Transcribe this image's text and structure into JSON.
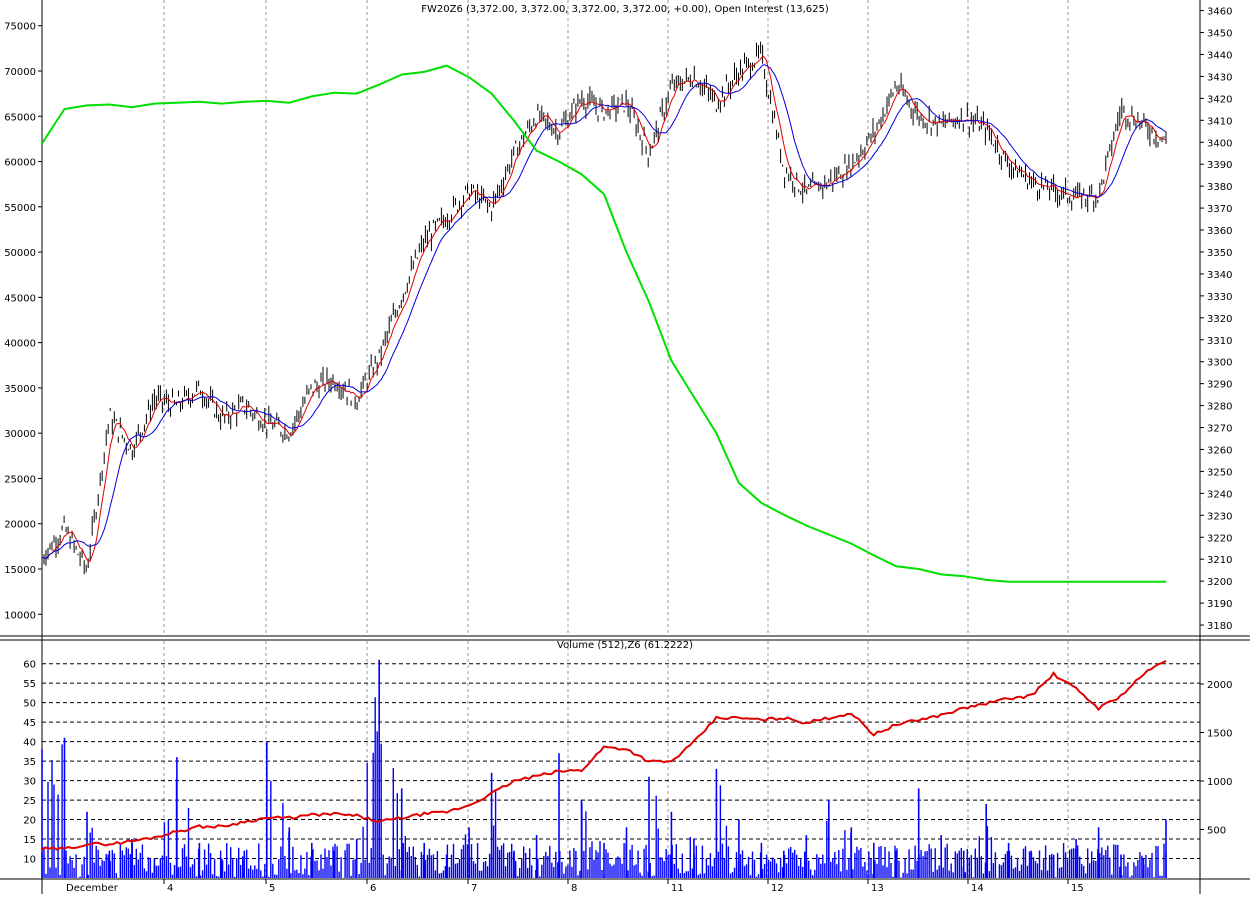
{
  "chart_data": [
    {
      "type": "line",
      "title": "FW20Z6 (3,372.00, 3,372.00, 3,372.00, 3,372.00, +0.00), Open Interest (13,625)",
      "x_labels": [
        "December",
        "4",
        "5",
        "6",
        "7",
        "8",
        "11",
        "12",
        "13",
        "14",
        "15"
      ],
      "left_axis": {
        "ticks": [
          10000,
          15000,
          20000,
          25000,
          30000,
          35000,
          40000,
          45000,
          50000,
          55000,
          60000,
          65000,
          70000,
          75000
        ],
        "range": [
          7600,
          77400
        ]
      },
      "right_axis": {
        "ticks": [
          3180,
          3190,
          3200,
          3210,
          3220,
          3230,
          3240,
          3250,
          3260,
          3270,
          3280,
          3290,
          3300,
          3310,
          3320,
          3330,
          3340,
          3350,
          3360,
          3370,
          3380,
          3390,
          3400,
          3410,
          3420,
          3430,
          3440,
          3450,
          3460
        ],
        "range": [
          3175,
          3463
        ]
      },
      "grid": "vertical dotted at session boundaries",
      "series": [
        {
          "kind": "price-bars",
          "axis": "right",
          "color": "#000000",
          "x": [
            0,
            2,
            4,
            6,
            8,
            10,
            12,
            14,
            16,
            18,
            20,
            22,
            24,
            26,
            28,
            30,
            32,
            34,
            36,
            38,
            40,
            42,
            44,
            46,
            48,
            50,
            52,
            54,
            56,
            58,
            60,
            62,
            64,
            66,
            68,
            70,
            72,
            74,
            76,
            78,
            80,
            82,
            84,
            86,
            88,
            90,
            92,
            94,
            96,
            98,
            100
          ],
          "values": [
            3211,
            3224,
            3205,
            3275,
            3260,
            3283,
            3280,
            3288,
            3274,
            3280,
            3272,
            3268,
            3288,
            3292,
            3283,
            3302,
            3330,
            3355,
            3366,
            3378,
            3370,
            3395,
            3412,
            3405,
            3420,
            3414,
            3418,
            3395,
            3425,
            3430,
            3418,
            3432,
            3440,
            3388,
            3377,
            3382,
            3390,
            3404,
            3426,
            3412,
            3408,
            3412,
            3406,
            3390,
            3382,
            3378,
            3375,
            3376,
            3415,
            3408,
            3400
          ]
        },
        {
          "kind": "open-interest",
          "axis": "left",
          "color": "#00e000",
          "x": [
            0,
            2,
            4,
            6,
            8,
            10,
            12,
            14,
            16,
            18,
            20,
            22,
            24,
            26,
            28,
            30,
            32,
            34,
            36,
            38,
            40,
            42,
            44,
            46,
            48,
            50,
            52,
            54,
            56,
            58,
            60,
            62,
            64,
            66,
            68,
            70,
            72,
            74,
            76,
            78,
            80,
            82,
            84,
            86,
            88,
            90,
            92,
            94,
            96,
            98,
            100
          ],
          "values": [
            62000,
            65800,
            66200,
            66300,
            66000,
            66400,
            66500,
            66600,
            66400,
            66600,
            66700,
            66500,
            67200,
            67600,
            67500,
            68500,
            69600,
            69900,
            70600,
            69300,
            67500,
            64500,
            61200,
            60000,
            58600,
            56400,
            50000,
            44500,
            38000,
            34000,
            30000,
            24500,
            22300,
            21000,
            19800,
            18800,
            17800,
            16500,
            15300,
            15000,
            14400,
            14200,
            13800,
            13600,
            13600,
            13600,
            13600,
            13600,
            13600,
            13600,
            13600
          ]
        }
      ]
    },
    {
      "type": "bar",
      "title": "Volume (512),Z6 (61.2222)",
      "left_axis": {
        "ticks": [
          10,
          15,
          20,
          25,
          30,
          35,
          40,
          45,
          50,
          55,
          60
        ],
        "range": [
          5,
          63
        ]
      },
      "right_axis": {
        "ticks": [
          500,
          1000,
          1500,
          2000
        ],
        "range": [
          0,
          2330
        ]
      },
      "grid": "horizontal dashed",
      "series": [
        {
          "kind": "volume-bars",
          "axis": "left",
          "color": "#0000ff",
          "x": [
            0,
            2,
            4,
            6,
            8,
            10,
            12,
            14,
            16,
            18,
            20,
            22,
            24,
            26,
            28,
            30,
            32,
            34,
            36,
            38,
            40,
            42,
            44,
            46,
            48,
            50,
            52,
            54,
            56,
            58,
            60,
            62,
            64,
            66,
            68,
            70,
            72,
            74,
            76,
            78,
            80,
            82,
            84,
            86,
            88,
            90,
            92,
            94,
            96,
            98,
            100
          ],
          "values": [
            38,
            41,
            22,
            12,
            15,
            10,
            36,
            14,
            10,
            12,
            40,
            18,
            14,
            12,
            15,
            61,
            28,
            14,
            11,
            18,
            32,
            12,
            16,
            37,
            25,
            14,
            18,
            31,
            22,
            15,
            33,
            20,
            14,
            12,
            16,
            25,
            18,
            14,
            12,
            28,
            16,
            12,
            24,
            14,
            12,
            11,
            15,
            18,
            11,
            10,
            20
          ]
        },
        {
          "kind": "cumulative-volume",
          "axis": "right",
          "color": "#e00000",
          "x": [
            0,
            2,
            4,
            6,
            8,
            10,
            12,
            14,
            16,
            18,
            20,
            22,
            24,
            26,
            28,
            30,
            32,
            34,
            36,
            38,
            40,
            42,
            44,
            46,
            48,
            50,
            52,
            54,
            56,
            58,
            60,
            62,
            64,
            66,
            68,
            70,
            72,
            74,
            76,
            78,
            80,
            82,
            84,
            86,
            88,
            90,
            92,
            94,
            96,
            98,
            100
          ],
          "values": [
            300,
            300,
            350,
            350,
            380,
            420,
            480,
            530,
            530,
            580,
            620,
            620,
            650,
            660,
            640,
            580,
            620,
            660,
            680,
            750,
            870,
            1000,
            1050,
            1100,
            1110,
            1350,
            1330,
            1200,
            1200,
            1400,
            1650,
            1650,
            1630,
            1650,
            1600,
            1650,
            1700,
            1480,
            1580,
            1630,
            1680,
            1750,
            1800,
            1850,
            1880,
            2100,
            1950,
            1750,
            1880,
            2100,
            2250
          ]
        }
      ]
    }
  ]
}
